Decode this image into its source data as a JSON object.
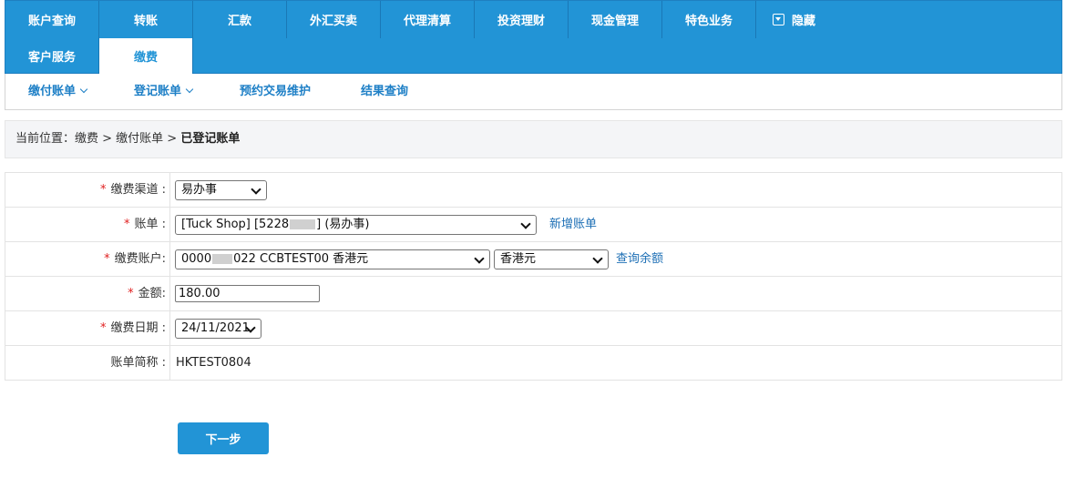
{
  "topnav": {
    "row1": [
      "账户查询",
      "转账",
      "汇款",
      "外汇买卖",
      "代理清算",
      "投资理财",
      "现金管理",
      "特色业务"
    ],
    "hide_label": "隐藏",
    "row2": [
      "客户服务",
      "缴费"
    ],
    "active": "缴费"
  },
  "subnav": {
    "pay_bill": "缴付账单",
    "register_bill": "登记账单",
    "scheduled": "预约交易维护",
    "result_query": "结果查询"
  },
  "breadcrumb": {
    "prefix": "当前位置：缴费 > 缴付账单 > ",
    "current": "已登记账单"
  },
  "form": {
    "channel_label": "缴费渠道 :",
    "channel_value": "易办事",
    "bill_label": "账单 :",
    "bill_value_pre": "[Tuck Shop] [5228",
    "bill_value_post": "] (易办事)",
    "add_bill_link": "新增账单",
    "account_label": "缴费账户:",
    "account_value_pre": "0000",
    "account_value_post": "022 CCBTEST00 香港元",
    "currency_value": "香港元",
    "balance_link": "查询余额",
    "amount_label": "金额:",
    "amount_value": "180.00",
    "date_label": "缴费日期 :",
    "date_value": "24/11/2021",
    "alias_label": "账单简称 :",
    "alias_value": "HKTEST0804",
    "required_mark": "*"
  },
  "next_button": "下一步",
  "colors": {
    "primary": "#2294d6",
    "link": "#1d6fb5",
    "required": "#e02020"
  }
}
